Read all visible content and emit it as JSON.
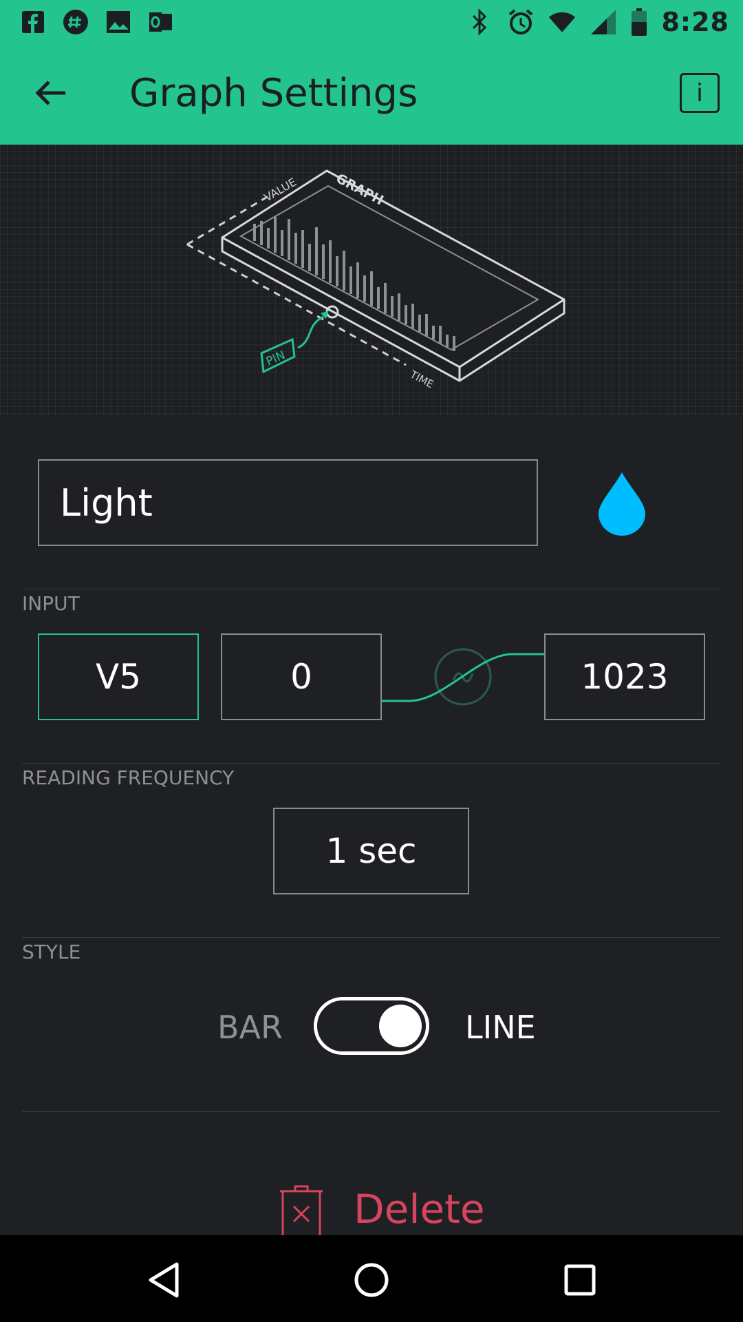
{
  "status_bar": {
    "time": "8:28",
    "left_icons": [
      "facebook-icon",
      "hashtag-app-icon",
      "image-icon",
      "outlook-icon"
    ],
    "right_icons": [
      "bluetooth-icon",
      "alarm-icon",
      "wifi-icon",
      "signal-icon",
      "battery-icon"
    ]
  },
  "app_bar": {
    "title": "Graph Settings",
    "info_label": "i"
  },
  "illustration": {
    "graph_label": "GRAPH",
    "value_label": "VALUE",
    "time_label": "TIME",
    "pin_label": "PIN"
  },
  "name_field": {
    "value": "Light"
  },
  "color": {
    "accent": "#23c48e",
    "widget_color": "#00bdff",
    "delete": "#d6455d"
  },
  "input": {
    "label": "INPUT",
    "pin": "V5",
    "min": "0",
    "max": "1023"
  },
  "reading_frequency": {
    "label": "READING FREQUENCY",
    "value": "1 sec"
  },
  "style": {
    "label": "STYLE",
    "left_option": "BAR",
    "right_option": "LINE",
    "selected": "LINE"
  },
  "delete": {
    "label": "Delete"
  }
}
